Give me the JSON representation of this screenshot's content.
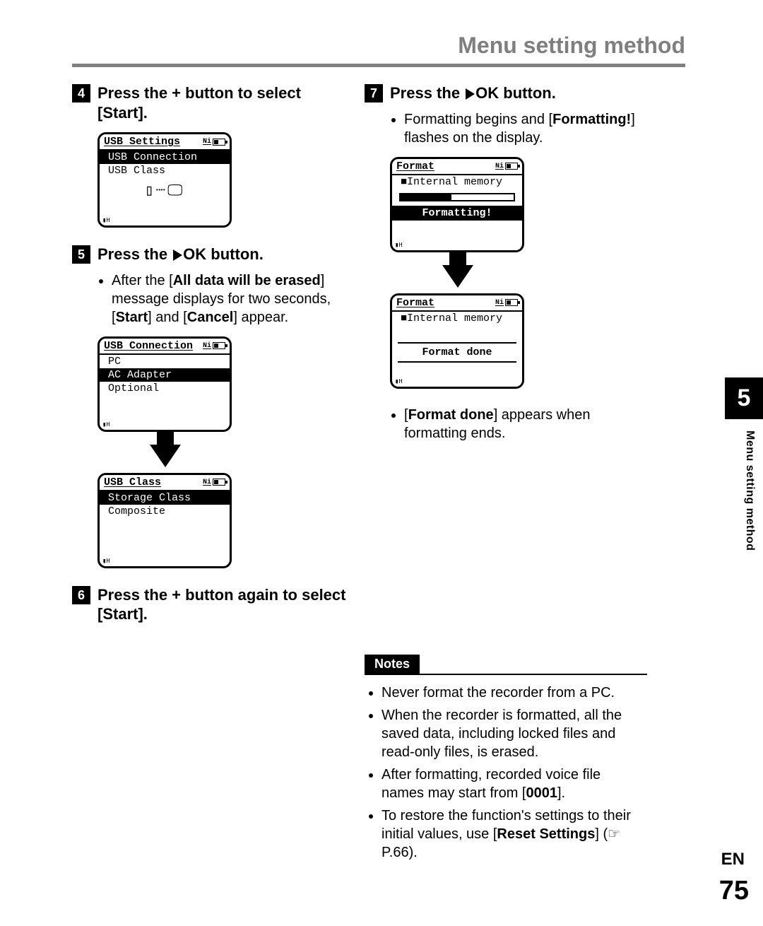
{
  "header": {
    "title": "Menu setting method"
  },
  "steps": {
    "s4": {
      "num": "4",
      "text_a": "Press the + button to select [",
      "bold_a": "Start",
      "text_b": "]."
    },
    "s5": {
      "num": "5",
      "text_a": "Press the ",
      "ok": "OK",
      "text_b": " button.",
      "bullet_a1": "After the [",
      "bullet_b1": "All data will be erased",
      "bullet_a2": "] message displays for two seconds, [",
      "bullet_b2": "Start",
      "bullet_a3": "] and [",
      "bullet_b3": "Cancel",
      "bullet_a4": "] appear."
    },
    "s6": {
      "num": "6",
      "text_a": "Press the + button again to select [",
      "bold_a": "Start",
      "text_b": "]."
    },
    "s7": {
      "num": "7",
      "text_a": "Press the ",
      "ok": "OK",
      "text_b": " button.",
      "b1_a": "Formatting begins and [",
      "b1_b": "Formatting!",
      "b1_c": "] flashes on the display.",
      "b2_a": "[",
      "b2_b": "Format done",
      "b2_c": "] appears when formatting ends."
    }
  },
  "lcd": {
    "ni": "Ni",
    "usb_settings": {
      "title": "USB Settings",
      "row1": "USB Connection",
      "row2": "USB Class"
    },
    "usb_conn": {
      "title": "USB Connection",
      "r1": "PC",
      "r2": "AC Adapter",
      "r3": "Optional"
    },
    "usb_class": {
      "title": "USB Class",
      "r1": "Storage Class",
      "r2": "Composite"
    },
    "format1": {
      "title": "Format",
      "row1": "Internal memory",
      "msg": "Formatting!"
    },
    "format2": {
      "title": "Format",
      "row1": "Internal memory",
      "msg": "Format done"
    },
    "foot": "▮H"
  },
  "notes": {
    "label": "Notes",
    "n1": "Never format the recorder from a PC.",
    "n2": "When the recorder is formatted, all the saved data, including locked files and read-only files, is erased.",
    "n3_a": "After formatting, recorded voice file names may start from [",
    "n3_b": "0001",
    "n3_c": "].",
    "n4_a": "To restore the function's settings to their initial values, use [",
    "n4_b": "Reset Settings",
    "n4_c": "] (☞ P.66)."
  },
  "sidebar": {
    "num": "5",
    "label": "Menu setting method"
  },
  "footer": {
    "lang": "EN",
    "page": "75"
  }
}
